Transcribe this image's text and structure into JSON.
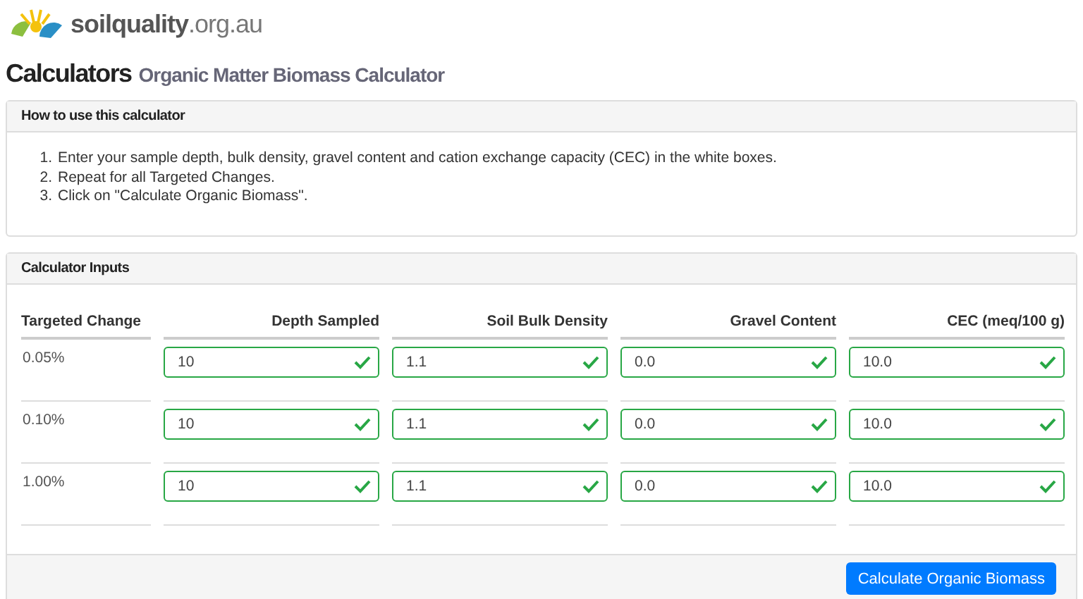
{
  "logo": {
    "name": "soilquality",
    "domain": ".org.au"
  },
  "heading": {
    "section": "Calculators",
    "title": "Organic Matter Biomass Calculator"
  },
  "instructions": {
    "title": "How to use this calculator",
    "steps": [
      {
        "marker": "1.",
        "text": "Enter your sample depth, bulk density, gravel content and cation exchange capacity (CEC) in the white boxes."
      },
      {
        "marker": "2.",
        "text": "Repeat for all Targeted Changes."
      },
      {
        "marker": "3.",
        "text": "Click on \"Calculate Organic Biomass\"."
      }
    ]
  },
  "inputs": {
    "title": "Calculator Inputs",
    "columns": [
      "Targeted Change",
      "Depth Sampled",
      "Soil Bulk Density",
      "Gravel Content",
      "CEC (meq/100 g)"
    ],
    "rows": [
      {
        "label": "0.05%",
        "fields": [
          {
            "value": "10",
            "valid": true
          },
          {
            "value": "1.1",
            "valid": true
          },
          {
            "value": "0.0",
            "valid": true
          },
          {
            "value": "10.0",
            "valid": true
          }
        ]
      },
      {
        "label": "0.10%",
        "fields": [
          {
            "value": "10",
            "valid": true
          },
          {
            "value": "1.1",
            "valid": true
          },
          {
            "value": "0.0",
            "valid": true
          },
          {
            "value": "10.0",
            "valid": true
          }
        ]
      },
      {
        "label": "1.00%",
        "fields": [
          {
            "value": "10",
            "valid": true
          },
          {
            "value": "1.1",
            "valid": true
          },
          {
            "value": "0.0",
            "valid": true
          },
          {
            "value": "10.0",
            "valid": true
          }
        ]
      }
    ],
    "button": "Calculate Organic Biomass"
  }
}
